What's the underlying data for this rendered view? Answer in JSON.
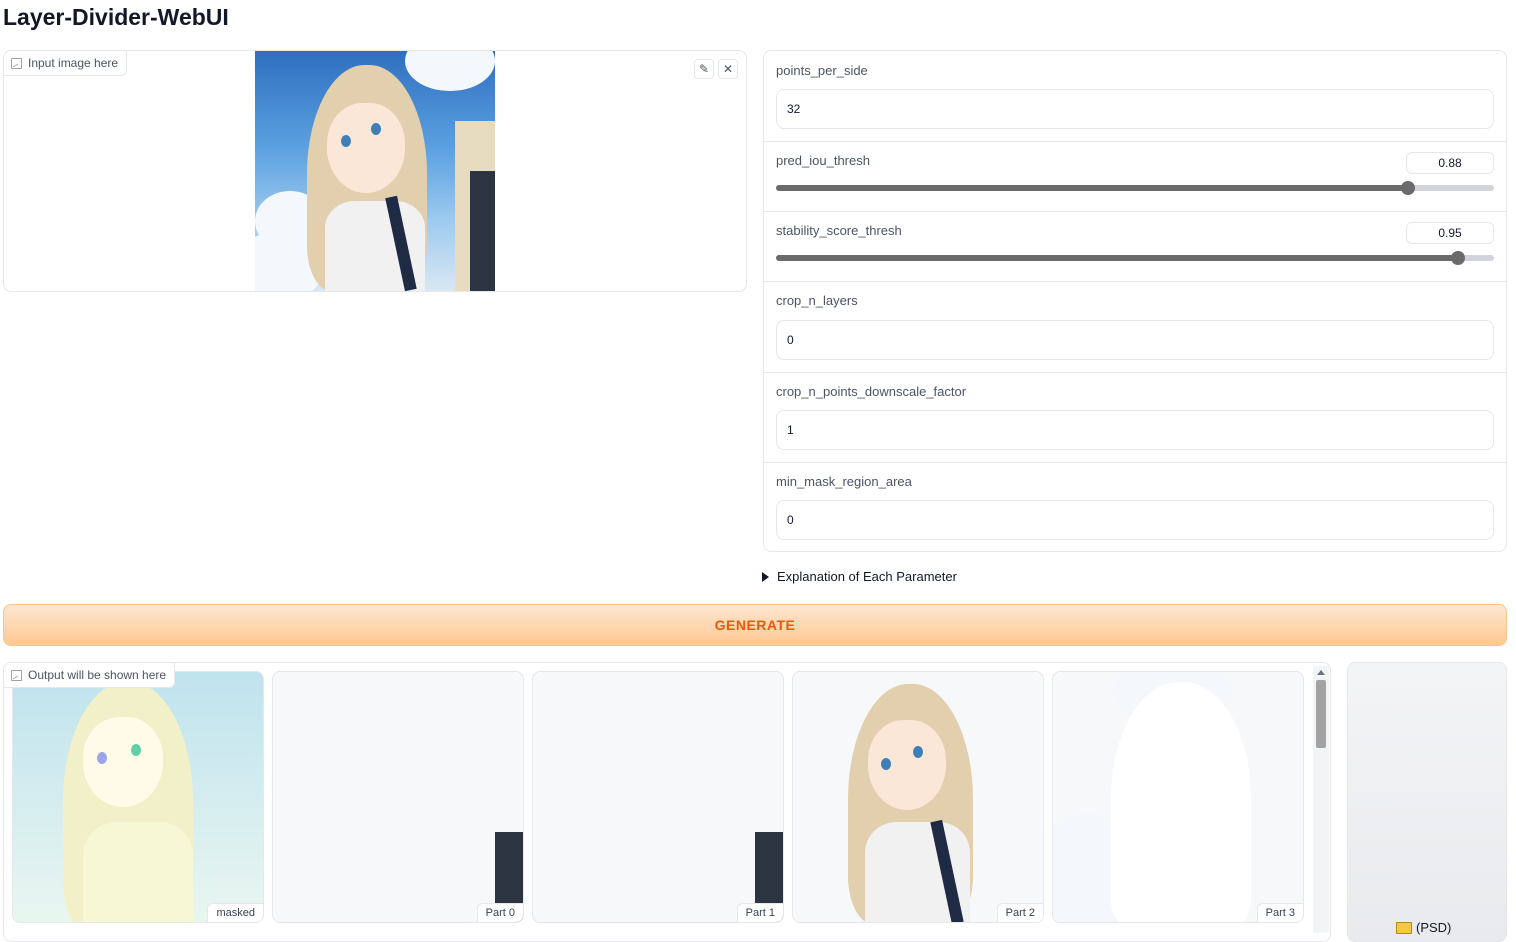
{
  "app": {
    "title": "Layer-Divider-WebUI"
  },
  "input_image": {
    "label": "Input image here",
    "edit_icon": "pencil-icon",
    "clear_icon": "close-icon",
    "edit_glyph": "✎",
    "clear_glyph": "✕"
  },
  "params": {
    "points_per_side": {
      "label": "points_per_side",
      "value": "32"
    },
    "pred_iou_thresh": {
      "label": "pred_iou_thresh",
      "value": "0.88",
      "fraction": 0.88
    },
    "stability_score_thresh": {
      "label": "stability_score_thresh",
      "value": "0.95",
      "fraction": 0.95
    },
    "crop_n_layers": {
      "label": "crop_n_layers",
      "value": "0"
    },
    "crop_n_points_downscale_factor": {
      "label": "crop_n_points_downscale_factor",
      "value": "1"
    },
    "min_mask_region_area": {
      "label": "min_mask_region_area",
      "value": "0"
    }
  },
  "accordion": {
    "label": "Explanation of Each Parameter"
  },
  "generate_button": {
    "label": "GENERATE"
  },
  "output": {
    "label": "Output will be shown here",
    "items": [
      {
        "caption": "masked"
      },
      {
        "caption": "Part 0"
      },
      {
        "caption": "Part 1"
      },
      {
        "caption": "Part 2"
      },
      {
        "caption": "Part 3"
      }
    ]
  },
  "file_output": {
    "label": "(PSD)",
    "icon": "folder-icon"
  },
  "colors": {
    "accent": "#ea580c",
    "slider": "#6b6b6b",
    "border": "#e5e7eb"
  }
}
